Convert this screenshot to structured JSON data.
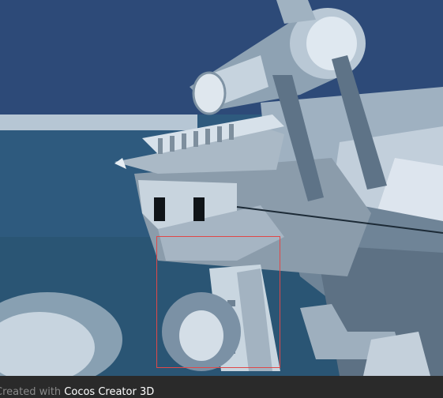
{
  "viewport": {
    "background_color": "#2d4a78",
    "model_name": "rifle-with-scope"
  },
  "selection": {
    "color": "#e04848"
  },
  "footer": {
    "prefix": "Created with ",
    "product": "Cocos Creator 3D",
    "prefix_color": "#8a8a8a",
    "product_color": "#ffffff"
  }
}
